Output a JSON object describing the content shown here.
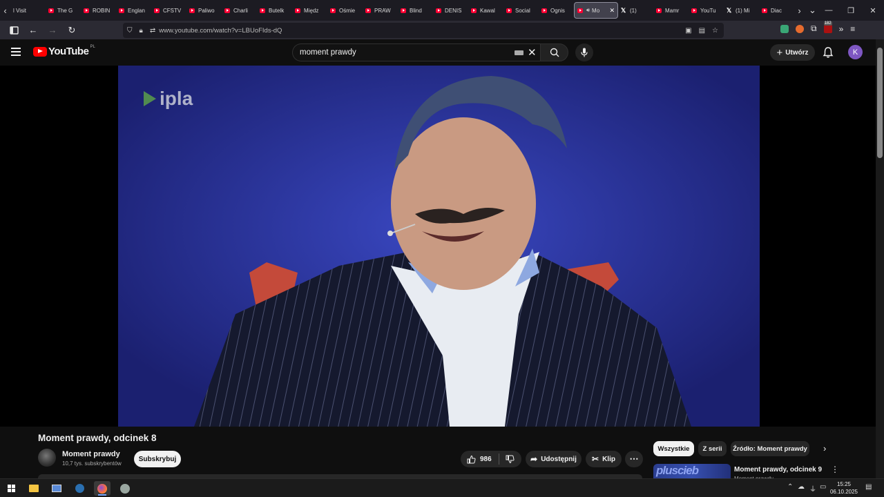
{
  "browser": {
    "tabs": [
      {
        "label": "l Visit",
        "icon": "none"
      },
      {
        "label": "The G",
        "icon": "youtube-icon"
      },
      {
        "label": "ROBIN",
        "icon": "youtube-icon"
      },
      {
        "label": "Englan",
        "icon": "youtube-icon"
      },
      {
        "label": "CFSTV",
        "icon": "youtube-icon"
      },
      {
        "label": "Paliwo",
        "icon": "youtube-icon"
      },
      {
        "label": "Charli",
        "icon": "youtube-icon"
      },
      {
        "label": "Butelk",
        "icon": "youtube-icon"
      },
      {
        "label": "Międz",
        "icon": "youtube-icon"
      },
      {
        "label": "Ośmie",
        "icon": "youtube-icon"
      },
      {
        "label": "PRAW",
        "icon": "youtube-icon"
      },
      {
        "label": "Blind",
        "icon": "youtube-icon"
      },
      {
        "label": "DENIS",
        "icon": "youtube-icon"
      },
      {
        "label": "Kawal",
        "icon": "youtube-icon"
      },
      {
        "label": "Social",
        "icon": "youtube-icon"
      },
      {
        "label": "Ognis",
        "icon": "youtube-icon"
      },
      {
        "label": "Mo",
        "icon": "youtube-icon",
        "active": true,
        "audio": true
      },
      {
        "label": "(1)",
        "icon": "x-icon"
      },
      {
        "label": "Mamr",
        "icon": "youtube-icon"
      },
      {
        "label": "YouTu",
        "icon": "youtube-icon"
      },
      {
        "label": "(1) Mi",
        "icon": "x-icon"
      },
      {
        "label": "Diac",
        "icon": "youtube-icon"
      }
    ],
    "url": "www.youtube.com/watch?v=LBUoFIds-dQ",
    "extensions_badge": "182"
  },
  "youtube": {
    "logo_text": "YouTube",
    "country_code": "PL",
    "search_value": "moment prawdy",
    "create_label": "Utwórz",
    "avatar_letter": "K"
  },
  "video": {
    "watermark": "ipla",
    "title": "Moment prawdy, odcinek 8",
    "channel_name": "Moment prawdy",
    "channel_subs": "10,7 tys. subskrybentów",
    "subscribe_label": "Subskrybuj",
    "likes": "986",
    "share_label": "Udostępnij",
    "clip_label": "Klip"
  },
  "related": {
    "chips": [
      "Wszystkie",
      "Z serii",
      "Źródło: Moment prawdy"
    ],
    "items": [
      {
        "title": "Moment prawdy, odcinek 9",
        "channel": "Moment prawdy",
        "thumb_text": "pluscieb"
      }
    ]
  },
  "taskbar": {
    "time": "15:25",
    "date": "06.10.2025"
  },
  "colors": {
    "yt_red": "#ff0000",
    "bg": "#0f0f0f",
    "avatar": "#7e57c2"
  }
}
